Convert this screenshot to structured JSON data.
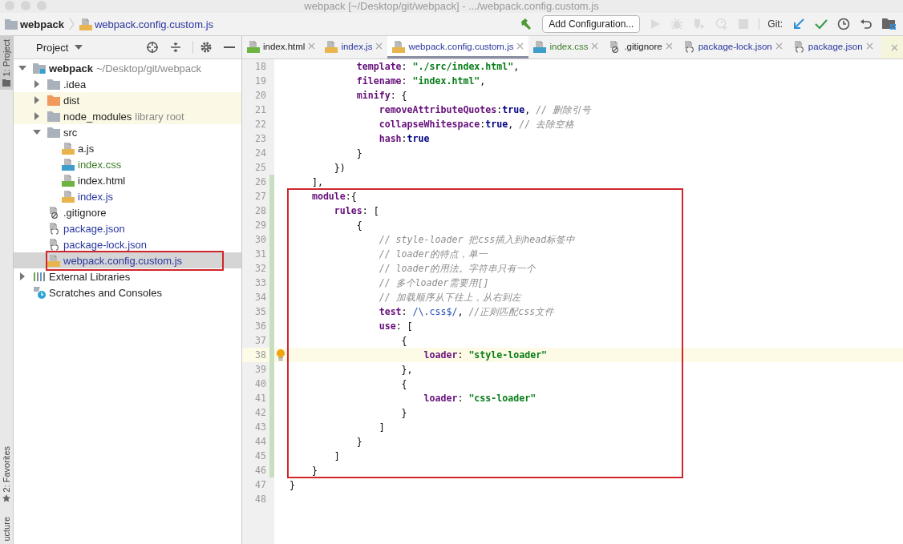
{
  "window": {
    "title": "webpack [~/Desktop/git/webpack] - .../webpack.config.custom.js"
  },
  "navigation_bar": {
    "breadcrumbs": [
      {
        "label": "webpack",
        "kind": "folder",
        "modified": false
      },
      {
        "label": "webpack.config.custom.js",
        "kind": "js",
        "modified": true
      }
    ],
    "toolbar": [
      {
        "kind": "hammer",
        "disabled": false
      },
      {
        "kind": "config",
        "label": "Add Configuration...",
        "disabled": false
      },
      {
        "kind": "run",
        "disabled": true
      },
      {
        "kind": "debug",
        "disabled": true
      },
      {
        "kind": "coverage",
        "disabled": true
      },
      {
        "kind": "profile",
        "disabled": true
      },
      {
        "kind": "stop",
        "disabled": true
      },
      {
        "kind": "label",
        "label": "Git:",
        "disabled": false
      },
      {
        "kind": "update",
        "disabled": false
      },
      {
        "kind": "commit",
        "disabled": false
      },
      {
        "kind": "history",
        "disabled": false
      },
      {
        "kind": "revert",
        "disabled": false
      },
      {
        "kind": "structure",
        "disabled": false
      }
    ]
  },
  "tool_strip": {
    "top": [
      {
        "label": "1: Project",
        "selected": true
      }
    ],
    "bottom": [
      {
        "label": "2: Favorites",
        "selected": false
      },
      {
        "label": "ucture",
        "selected": false
      }
    ]
  },
  "project_panel": {
    "title": "Project",
    "tree": [
      {
        "label": "webpack",
        "kind": "module",
        "hint": "~/Desktop/git/webpack",
        "modified": false,
        "added": false,
        "ignored": false,
        "selected": false,
        "boxed": false,
        "expanded": true,
        "children": [
          {
            "label": ".idea",
            "kind": "folder",
            "modified": false,
            "added": false,
            "ignored": false,
            "selected": false,
            "boxed": false,
            "expanded": false
          },
          {
            "label": "dist",
            "kind": "excluded",
            "modified": false,
            "added": false,
            "ignored": true,
            "selected": false,
            "boxed": false,
            "expanded": false
          },
          {
            "label": "node_modules",
            "kind": "folder",
            "hint": "library root",
            "modified": false,
            "added": false,
            "ignored": true,
            "selected": false,
            "boxed": false,
            "expanded": false
          },
          {
            "label": "src",
            "kind": "folder",
            "modified": false,
            "added": false,
            "ignored": false,
            "selected": false,
            "boxed": false,
            "expanded": true,
            "children": [
              {
                "label": "a.js",
                "kind": "js",
                "modified": false,
                "added": false,
                "ignored": false,
                "selected": false,
                "boxed": false
              },
              {
                "label": "index.css",
                "kind": "css",
                "modified": false,
                "added": true,
                "ignored": false,
                "selected": false,
                "boxed": false
              },
              {
                "label": "index.html",
                "kind": "html",
                "modified": false,
                "added": false,
                "ignored": false,
                "selected": false,
                "boxed": false
              },
              {
                "label": "index.js",
                "kind": "js",
                "modified": true,
                "added": false,
                "ignored": false,
                "selected": false,
                "boxed": false
              }
            ]
          },
          {
            "label": ".gitignore",
            "kind": "gitignore",
            "modified": false,
            "added": false,
            "ignored": false,
            "selected": false,
            "boxed": false
          },
          {
            "label": "package.json",
            "kind": "json",
            "modified": true,
            "added": false,
            "ignored": false,
            "selected": false,
            "boxed": false
          },
          {
            "label": "package-lock.json",
            "kind": "json",
            "modified": true,
            "added": false,
            "ignored": false,
            "selected": false,
            "boxed": false
          },
          {
            "label": "webpack.config.custom.js",
            "kind": "js",
            "modified": true,
            "added": false,
            "ignored": false,
            "selected": true,
            "boxed": true
          }
        ]
      },
      {
        "label": "External Libraries",
        "kind": "libraries",
        "modified": false,
        "added": false,
        "ignored": false,
        "selected": false,
        "boxed": false,
        "expanded": false
      },
      {
        "label": "Scratches and Consoles",
        "kind": "scratches",
        "modified": false,
        "added": false,
        "ignored": false,
        "selected": false,
        "boxed": false
      }
    ]
  },
  "editor": {
    "tabs": [
      {
        "label": "index.html",
        "kind": "html",
        "modified": false,
        "added": false,
        "selected": false
      },
      {
        "label": "index.js",
        "kind": "js",
        "modified": true,
        "added": false,
        "selected": false
      },
      {
        "label": "webpack.config.custom.js",
        "kind": "js",
        "modified": true,
        "added": false,
        "selected": true
      },
      {
        "label": "index.css",
        "kind": "css",
        "modified": false,
        "added": true,
        "selected": false
      },
      {
        "label": ".gitignore",
        "kind": "gitignore",
        "modified": false,
        "added": false,
        "selected": false
      },
      {
        "label": "package-lock.json",
        "kind": "json",
        "modified": true,
        "added": false,
        "selected": false
      },
      {
        "label": "package.json",
        "kind": "json",
        "modified": true,
        "added": false,
        "selected": false
      }
    ],
    "lines": [
      {
        "number": "18",
        "changed": false,
        "current": false,
        "boxed": false,
        "bulb": false,
        "tokens": [
          {
            "kind": "key",
            "text": "            template"
          },
          {
            "kind": "plain",
            "text": ": "
          },
          {
            "kind": "string",
            "text": "\"./src/index.html\""
          },
          {
            "kind": "plain",
            "text": ","
          }
        ]
      },
      {
        "number": "19",
        "changed": false,
        "current": false,
        "boxed": false,
        "bulb": false,
        "tokens": [
          {
            "kind": "key",
            "text": "            filename"
          },
          {
            "kind": "plain",
            "text": ": "
          },
          {
            "kind": "string",
            "text": "\"index.html\""
          },
          {
            "kind": "plain",
            "text": ","
          }
        ]
      },
      {
        "number": "20",
        "changed": false,
        "current": false,
        "boxed": false,
        "bulb": false,
        "tokens": [
          {
            "kind": "key",
            "text": "            minify"
          },
          {
            "kind": "plain",
            "text": ": {"
          }
        ]
      },
      {
        "number": "21",
        "changed": false,
        "current": false,
        "boxed": false,
        "bulb": false,
        "tokens": [
          {
            "kind": "key",
            "text": "                removeAttributeQuotes"
          },
          {
            "kind": "plain",
            "text": ":"
          },
          {
            "kind": "keyword",
            "text": "true"
          },
          {
            "kind": "plain",
            "text": ", "
          },
          {
            "kind": "comment",
            "text": "// 删除引号"
          }
        ]
      },
      {
        "number": "22",
        "changed": false,
        "current": false,
        "boxed": false,
        "bulb": false,
        "tokens": [
          {
            "kind": "key",
            "text": "                collapseWhitespace"
          },
          {
            "kind": "plain",
            "text": ":"
          },
          {
            "kind": "keyword",
            "text": "true"
          },
          {
            "kind": "plain",
            "text": ", "
          },
          {
            "kind": "comment",
            "text": "// 去除空格"
          }
        ]
      },
      {
        "number": "23",
        "changed": false,
        "current": false,
        "boxed": false,
        "bulb": false,
        "tokens": [
          {
            "kind": "key",
            "text": "                hash"
          },
          {
            "kind": "plain",
            "text": ":"
          },
          {
            "kind": "keyword",
            "text": "true"
          }
        ]
      },
      {
        "number": "24",
        "changed": false,
        "current": false,
        "boxed": false,
        "bulb": false,
        "tokens": [
          {
            "kind": "plain",
            "text": "            }"
          }
        ]
      },
      {
        "number": "25",
        "changed": false,
        "current": false,
        "boxed": false,
        "bulb": false,
        "tokens": [
          {
            "kind": "plain",
            "text": "        })"
          }
        ]
      },
      {
        "number": "26",
        "changed": true,
        "current": false,
        "boxed": false,
        "bulb": false,
        "tokens": [
          {
            "kind": "plain",
            "text": "    ],"
          }
        ]
      },
      {
        "number": "27",
        "changed": true,
        "current": false,
        "boxed": true,
        "bulb": false,
        "tokens": [
          {
            "kind": "key",
            "text": "    module"
          },
          {
            "kind": "plain",
            "text": ":{"
          }
        ]
      },
      {
        "number": "28",
        "changed": true,
        "current": false,
        "boxed": true,
        "bulb": false,
        "tokens": [
          {
            "kind": "key",
            "text": "        rules"
          },
          {
            "kind": "plain",
            "text": ": ["
          }
        ]
      },
      {
        "number": "29",
        "changed": true,
        "current": false,
        "boxed": true,
        "bulb": false,
        "tokens": [
          {
            "kind": "plain",
            "text": "            {"
          }
        ]
      },
      {
        "number": "30",
        "changed": true,
        "current": false,
        "boxed": true,
        "bulb": false,
        "tokens": [
          {
            "kind": "comment",
            "text": "                // style-loader 把css插入到head标签中"
          }
        ]
      },
      {
        "number": "31",
        "changed": true,
        "current": false,
        "boxed": true,
        "bulb": false,
        "tokens": [
          {
            "kind": "comment",
            "text": "                // loader的特点，单一"
          }
        ]
      },
      {
        "number": "32",
        "changed": true,
        "current": false,
        "boxed": true,
        "bulb": false,
        "tokens": [
          {
            "kind": "comment",
            "text": "                // loader的用法。字符串只有一个"
          }
        ]
      },
      {
        "number": "33",
        "changed": true,
        "current": false,
        "boxed": true,
        "bulb": false,
        "tokens": [
          {
            "kind": "comment",
            "text": "                // 多个loader需要用[]"
          }
        ]
      },
      {
        "number": "34",
        "changed": true,
        "current": false,
        "boxed": true,
        "bulb": false,
        "tokens": [
          {
            "kind": "comment",
            "text": "                // 加载顺序从下往上，从右到左"
          }
        ]
      },
      {
        "number": "35",
        "changed": true,
        "current": false,
        "boxed": true,
        "bulb": false,
        "tokens": [
          {
            "kind": "key",
            "text": "                test"
          },
          {
            "kind": "plain",
            "text": ": "
          },
          {
            "kind": "regex",
            "text": "/\\.css$/"
          },
          {
            "kind": "plain",
            "text": ", "
          },
          {
            "kind": "comment",
            "text": "//正则匹配css文件"
          }
        ]
      },
      {
        "number": "36",
        "changed": true,
        "current": false,
        "boxed": true,
        "bulb": false,
        "tokens": [
          {
            "kind": "key",
            "text": "                use"
          },
          {
            "kind": "plain",
            "text": ": ["
          }
        ]
      },
      {
        "number": "37",
        "changed": true,
        "current": false,
        "boxed": true,
        "bulb": false,
        "tokens": [
          {
            "kind": "plain",
            "text": "                    {"
          }
        ]
      },
      {
        "number": "38",
        "changed": true,
        "current": true,
        "boxed": true,
        "bulb": true,
        "tokens": [
          {
            "kind": "key",
            "text": "                        loader"
          },
          {
            "kind": "plain",
            "text": ": "
          },
          {
            "kind": "string",
            "text": "\"style-loader\""
          }
        ]
      },
      {
        "number": "39",
        "changed": true,
        "current": false,
        "boxed": true,
        "bulb": false,
        "tokens": [
          {
            "kind": "plain",
            "text": "                    },"
          }
        ]
      },
      {
        "number": "40",
        "changed": true,
        "current": false,
        "boxed": true,
        "bulb": false,
        "tokens": [
          {
            "kind": "plain",
            "text": "                    {"
          }
        ]
      },
      {
        "number": "41",
        "changed": true,
        "current": false,
        "boxed": true,
        "bulb": false,
        "tokens": [
          {
            "kind": "key",
            "text": "                        loader"
          },
          {
            "kind": "plain",
            "text": ": "
          },
          {
            "kind": "string",
            "text": "\"css-loader\""
          }
        ]
      },
      {
        "number": "42",
        "changed": true,
        "current": false,
        "boxed": true,
        "bulb": false,
        "tokens": [
          {
            "kind": "plain",
            "text": "                    }"
          }
        ]
      },
      {
        "number": "43",
        "changed": true,
        "current": false,
        "boxed": true,
        "bulb": false,
        "tokens": [
          {
            "kind": "plain",
            "text": "                ]"
          }
        ]
      },
      {
        "number": "44",
        "changed": true,
        "current": false,
        "boxed": true,
        "bulb": false,
        "tokens": [
          {
            "kind": "plain",
            "text": "            }"
          }
        ]
      },
      {
        "number": "45",
        "changed": true,
        "current": false,
        "boxed": true,
        "bulb": false,
        "tokens": [
          {
            "kind": "plain",
            "text": "        ]"
          }
        ]
      },
      {
        "number": "46",
        "changed": true,
        "current": false,
        "boxed": true,
        "bulb": false,
        "tokens": [
          {
            "kind": "plain",
            "text": "    }"
          }
        ]
      },
      {
        "number": "47",
        "changed": false,
        "current": false,
        "boxed": false,
        "bulb": false,
        "tokens": [
          {
            "kind": "plain",
            "text": "}"
          }
        ]
      },
      {
        "number": "48",
        "changed": false,
        "current": false,
        "boxed": false,
        "bulb": false
      }
    ]
  }
}
